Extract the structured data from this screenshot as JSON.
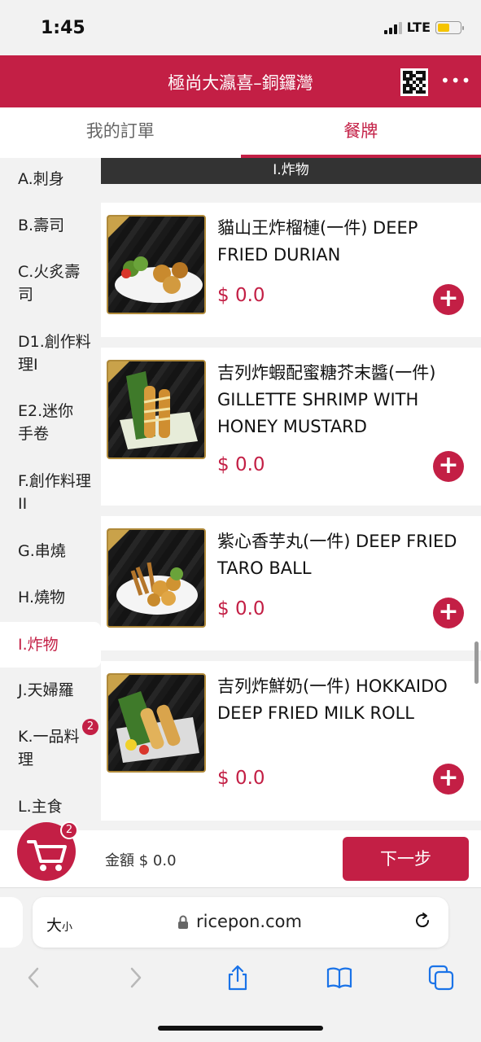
{
  "status_bar": {
    "time": "1:45",
    "network": "LTE"
  },
  "header": {
    "title": "極尚大瀛喜–銅鑼灣"
  },
  "tabs": [
    {
      "label": "我的訂單",
      "active": false
    },
    {
      "label": "餐牌",
      "active": true
    }
  ],
  "sidebar": {
    "categories": [
      {
        "label": "A.刺身"
      },
      {
        "label": "B.壽司"
      },
      {
        "label": "C.火炙壽司"
      },
      {
        "label": "D1.創作料理I"
      },
      {
        "label": "E2.迷你手卷"
      },
      {
        "label": "F.創作料理II"
      },
      {
        "label": "G.串燒"
      },
      {
        "label": "H.燒物"
      },
      {
        "label": "I.炸物",
        "active": true
      },
      {
        "label": "J.天婦羅"
      },
      {
        "label": "K.一品料理",
        "badge": "2"
      },
      {
        "label": "L.主食"
      }
    ]
  },
  "section": {
    "title": "I.炸物"
  },
  "dishes": [
    {
      "name": "貓山王炸榴槤(一件) DEEP FRIED DURIAN",
      "price": "$ 0.0"
    },
    {
      "name": "吉列炸蝦配蜜糖芥末醬(一件) GILLETTE SHRIMP WITH HONEY MUSTARD",
      "price": "$ 0.0"
    },
    {
      "name": "紫心香芋丸(一件) DEEP FRIED TARO BALL",
      "price": "$ 0.0"
    },
    {
      "name": "吉列炸鮮奶(一件) HOKKAIDO DEEP FRIED MILK ROLL",
      "price": "$ 0.0"
    }
  ],
  "cart": {
    "count": "2",
    "total_label": "金額 $ 0.0",
    "next_label": "下一步"
  },
  "browser": {
    "text_size_big": "大",
    "text_size_small": "小",
    "url": "ricepon.com"
  },
  "colors": {
    "brand": "#c31f45",
    "section_bar": "#333333",
    "price": "#c31f45"
  },
  "icons": [
    "qr-code-icon",
    "more-icon",
    "cart-icon",
    "plus-icon",
    "lock-icon",
    "reload-icon",
    "back-icon",
    "forward-icon",
    "share-icon",
    "bookmarks-icon",
    "tabs-icon"
  ]
}
